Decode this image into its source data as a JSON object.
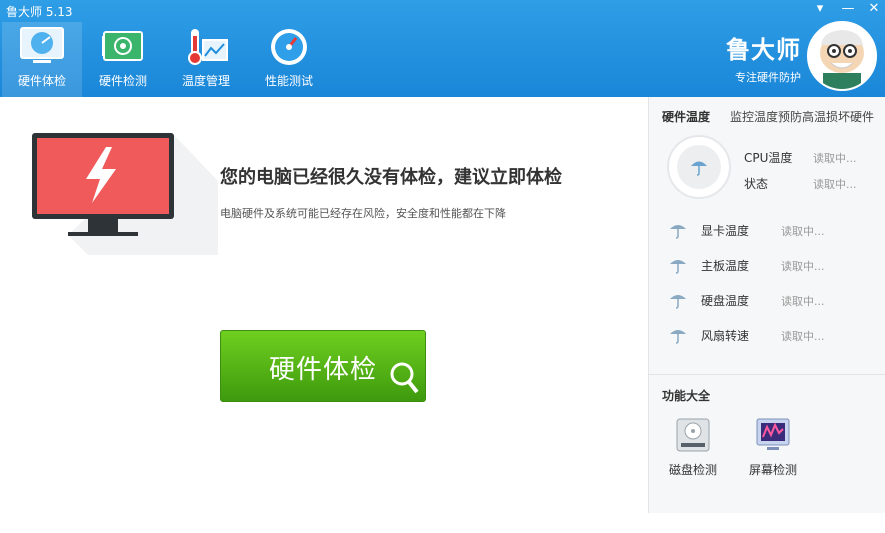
{
  "app": {
    "title": "鲁大师 5.13",
    "brand_name": "鲁大师",
    "brand_tagline": "专注硬件防护"
  },
  "window_controls": {
    "menu": "▾",
    "minimize": "—",
    "close": "✕"
  },
  "nav": [
    {
      "label": "硬件体检",
      "icon": "monitor-check-icon",
      "active": true
    },
    {
      "label": "硬件检测",
      "icon": "circuit-board-icon",
      "active": false
    },
    {
      "label": "温度管理",
      "icon": "thermometer-icon",
      "active": false
    },
    {
      "label": "性能测试",
      "icon": "speedometer-icon",
      "active": false
    }
  ],
  "main": {
    "headline": "您的电脑已经很久没有体检，建议立即体检",
    "subline": "电脑硬件及系统可能已经存在风险，安全度和性能都在下降",
    "check_button": "硬件体检",
    "monitor_icon": "monitor-alert-icon",
    "search_icon": "magnifier-icon"
  },
  "temperature": {
    "title": "硬件温度",
    "desc": "监控温度预防高温损坏硬件",
    "cpu_label": "CPU温度",
    "cpu_value": "读取中...",
    "status_label": "状态",
    "status_value": "读取中...",
    "rows": [
      {
        "name": "显卡温度",
        "value": "读取中..."
      },
      {
        "name": "主板温度",
        "value": "读取中..."
      },
      {
        "name": "硬盘温度",
        "value": "读取中..."
      },
      {
        "name": "风扇转速",
        "value": "读取中..."
      }
    ]
  },
  "tools": {
    "title": "功能大全",
    "items": [
      {
        "label": "磁盘检测",
        "icon": "disk-check-icon"
      },
      {
        "label": "屏幕检测",
        "icon": "screen-check-icon"
      }
    ]
  },
  "colors": {
    "header": "#1f8fdd",
    "button_green": "#4caf14",
    "monitor_red": "#f05a5a"
  }
}
